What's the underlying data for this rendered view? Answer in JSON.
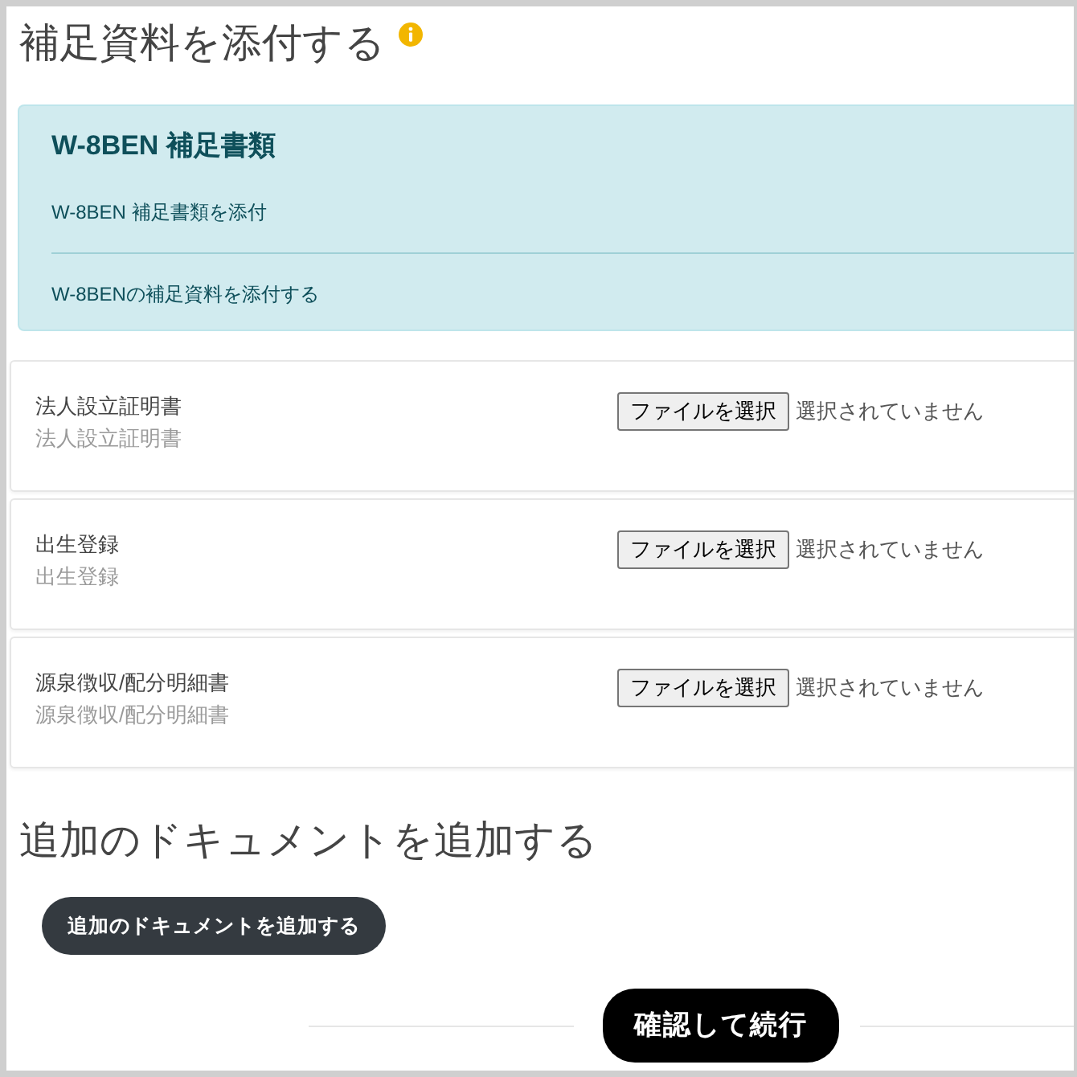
{
  "page": {
    "title": "補足資料を添付する"
  },
  "info_panel": {
    "title": "W-8BEN 補足書類",
    "items": [
      "W-8BEN 補足書類を添付",
      "W-8BENの補足資料を添付する"
    ]
  },
  "documents": [
    {
      "label": "法人設立証明書",
      "description": "法人設立証明書",
      "button": "ファイルを選択",
      "status": "選択されていません"
    },
    {
      "label": "出生登録",
      "description": "出生登録",
      "button": "ファイルを選択",
      "status": "選択されていません"
    },
    {
      "label": "源泉徴収/配分明細書",
      "description": "源泉徴収/配分明細書",
      "button": "ファイルを選択",
      "status": "選択されていません"
    }
  ],
  "additional": {
    "heading": "追加のドキュメントを追加する",
    "button": "追加のドキュメントを追加する"
  },
  "footer": {
    "button": "確認して続行"
  }
}
